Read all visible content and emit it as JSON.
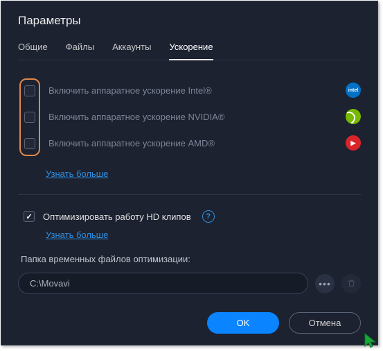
{
  "title": "Параметры",
  "tabs": {
    "general": "Общие",
    "files": "Файлы",
    "accounts": "Аккаунты",
    "acceleration": "Ускорение"
  },
  "hw": {
    "intel_label": "Включить аппаратное ускорение Intel®",
    "nvidia_label": "Включить аппаратное ускорение NVIDIA®",
    "amd_label": "Включить аппаратное ускорение AMD®",
    "learn_more": "Узнать больше",
    "intel_badge": "intel"
  },
  "optimize": {
    "label": "Оптимизировать работу HD клипов",
    "learn_more": "Узнать больше"
  },
  "folder": {
    "label": "Папка временных файлов оптимизации:",
    "path": "C:\\Movavi"
  },
  "buttons": {
    "ok": "OK",
    "cancel": "Отмена"
  },
  "brand_amd_text": "▶"
}
